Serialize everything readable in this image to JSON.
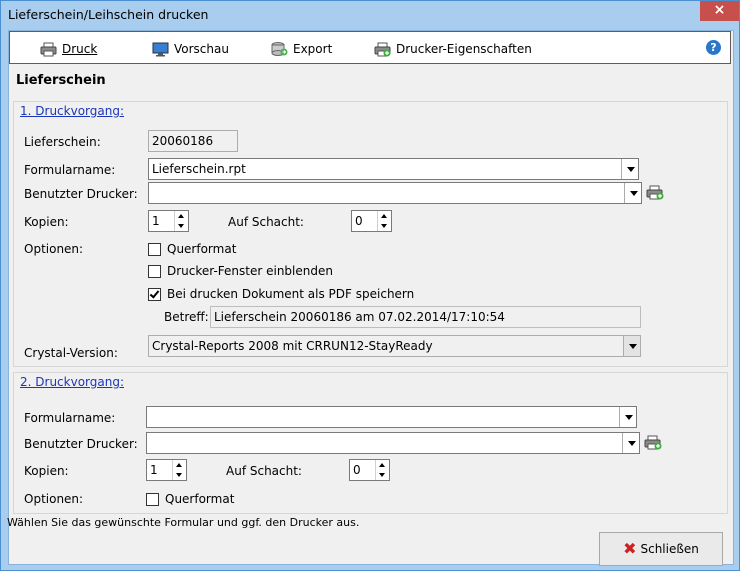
{
  "window": {
    "title": "Lieferschein/Leihschein drucken",
    "close": "×"
  },
  "toolbar": {
    "druck_label": "Druck",
    "vorschau_label": "Vorschau",
    "export_label": "Export",
    "props_label": "Drucker-Eigenschaften",
    "help": "?"
  },
  "heading": "Lieferschein",
  "group1": {
    "title": "1. Druckvorgang:",
    "lieferschein_label": "Lieferschein:",
    "lieferschein_value": "20060186",
    "formularname_label": "Formularname:",
    "formularname_value": "Lieferschein.rpt",
    "drucker_label": "Benutzter Drucker:",
    "drucker_value": "",
    "kopien_label": "Kopien:",
    "kopien_value": "1",
    "schacht_label": "Auf Schacht:",
    "schacht_value": "0",
    "optionen_label": "Optionen:",
    "opt_querformat": "Querformat",
    "opt_fenster": "Drucker-Fenster einblenden",
    "opt_pdf": "Bei drucken Dokument als PDF speichern",
    "betreff_label": "Betreff:",
    "betreff_value": "Lieferschein 20060186 am 07.02.2014/17:10:54",
    "crystal_label": "Crystal-Version:",
    "crystal_value": "Crystal-Reports 2008 mit CRRUN12-StayReady"
  },
  "group2": {
    "title": "2. Druckvorgang:",
    "formularname_label": "Formularname:",
    "formularname_value": "",
    "drucker_label": "Benutzter Drucker:",
    "drucker_value": "",
    "kopien_label": "Kopien:",
    "kopien_value": "1",
    "schacht_label": "Auf Schacht:",
    "schacht_value": "0",
    "optionen_label": "Optionen:",
    "opt_querformat": "Querformat"
  },
  "status_text": "Wählen Sie das gewünschte Formular und ggf. den Drucker aus.",
  "footer": {
    "close_label": "Schließen"
  },
  "colors": {
    "frame": "#a8cdee",
    "close": "#c7504c",
    "link": "#1c36b8"
  }
}
